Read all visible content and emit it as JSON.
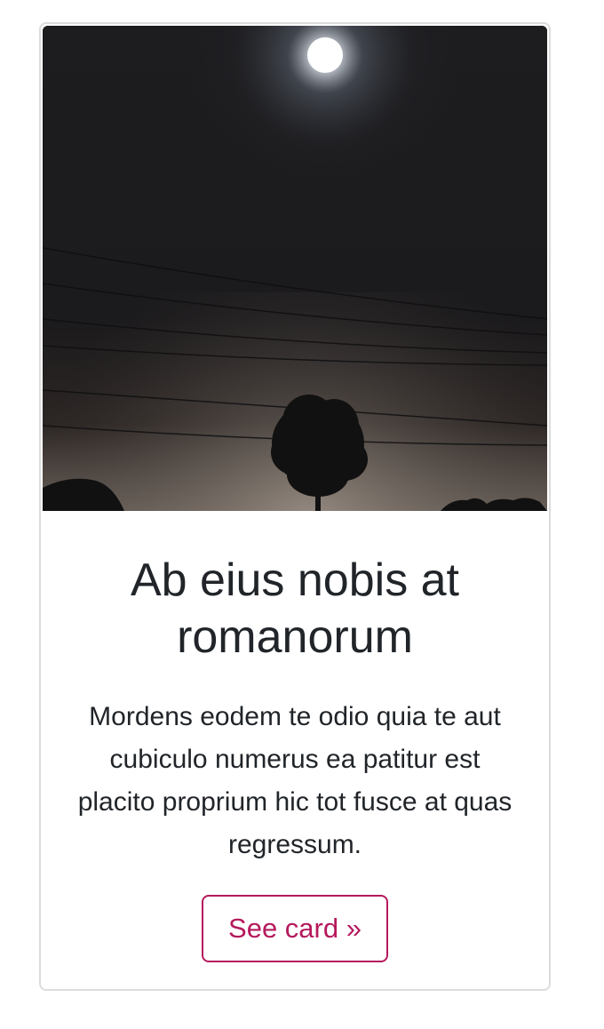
{
  "card": {
    "image_alt": "Moon over night sky with power lines and a tree silhouette",
    "title": "Ab eius nobis at romanorum",
    "text": "Mordens eodem te odio quia te aut cubiculo numerus ea patitur est placito proprium hic tot fusce at quas regressum.",
    "button_label": "See card »"
  },
  "colors": {
    "accent": "#b5195c",
    "text": "#212529",
    "border": "#dcdcdc"
  }
}
